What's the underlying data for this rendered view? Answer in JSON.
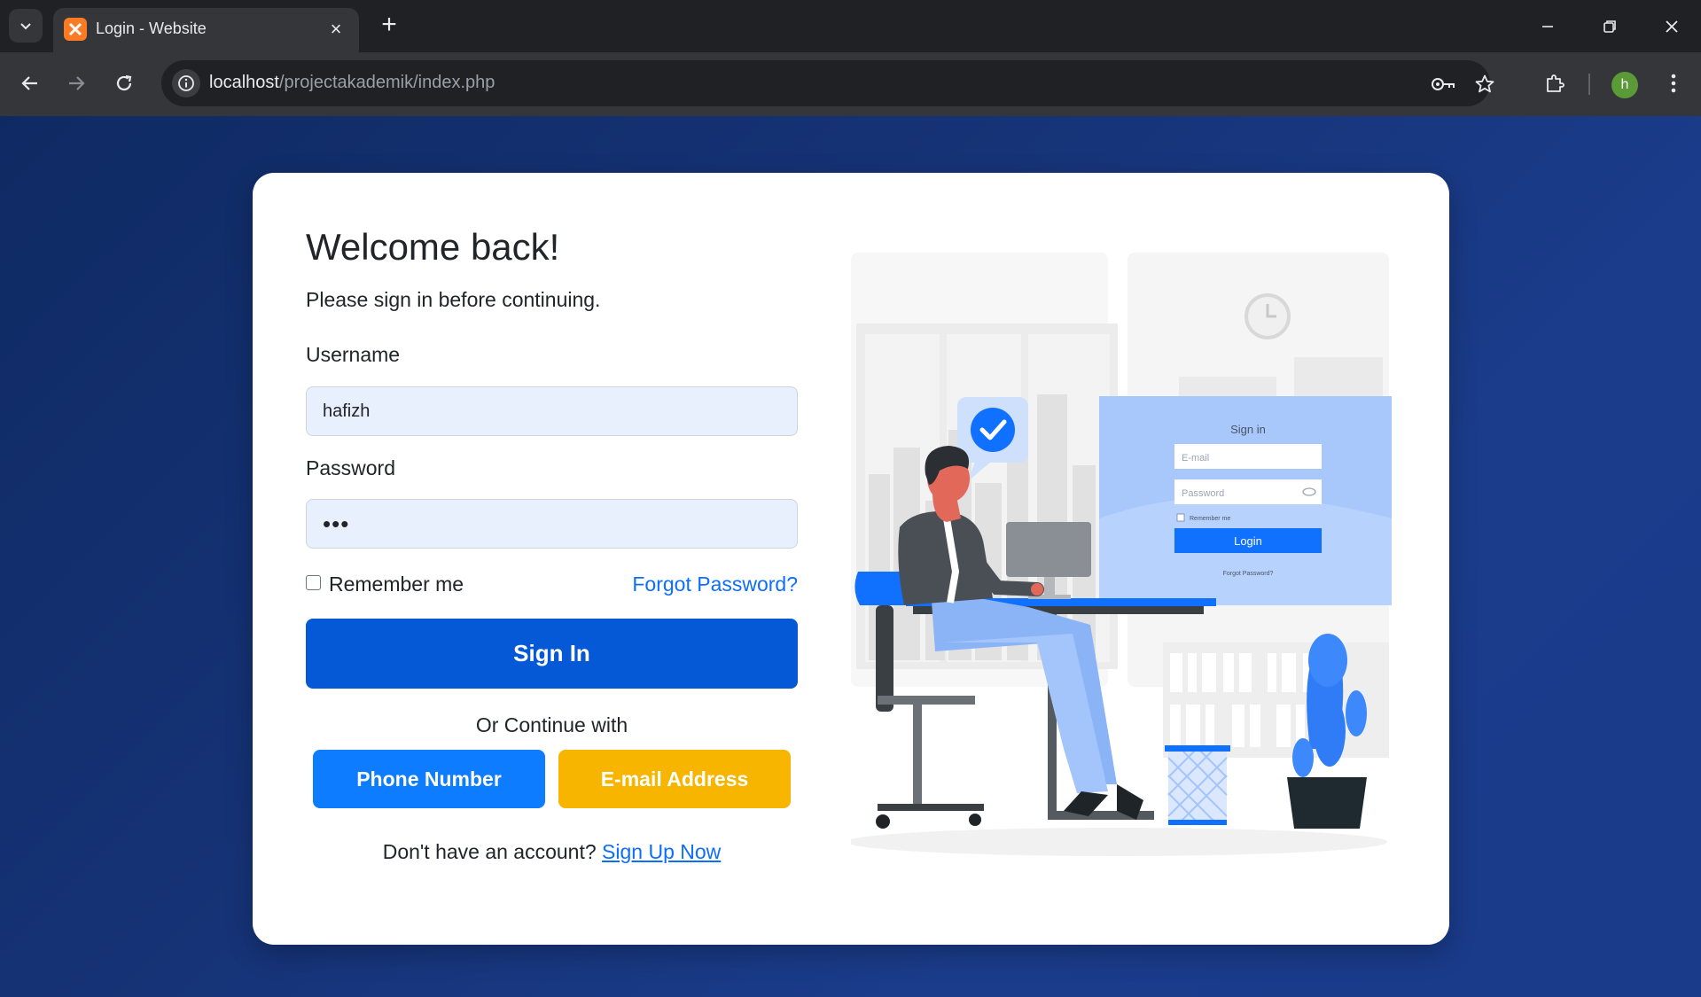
{
  "browser": {
    "tab_title": "Login - Website",
    "url_host": "localhost",
    "url_path": "/projectakademik/index.php",
    "profile_initial": "h"
  },
  "login": {
    "heading": "Welcome back!",
    "subtitle": "Please sign in before continuing.",
    "username_label": "Username",
    "username_value": "hafizh",
    "password_label": "Password",
    "password_value": "•••",
    "remember_label": "Remember me",
    "forgot_label": "Forgot Password?",
    "signin_label": "Sign In",
    "or_label": "Or Continue with",
    "phone_label": "Phone Number",
    "email_label": "E-mail Address",
    "no_account_text": "Don't have an account?",
    "signup_label": "Sign Up Now"
  },
  "illustration": {
    "form_title": "Sign in",
    "email_placeholder": "E-mail",
    "password_placeholder": "Password",
    "remember": "Remember me",
    "login_button": "Login",
    "forgot": "Forgot Password?"
  },
  "colors": {
    "primary": "#0559d6",
    "phone_button": "#0d7cff",
    "email_button": "#f7b500",
    "link": "#0d6efd",
    "page_bg": "#163377"
  }
}
